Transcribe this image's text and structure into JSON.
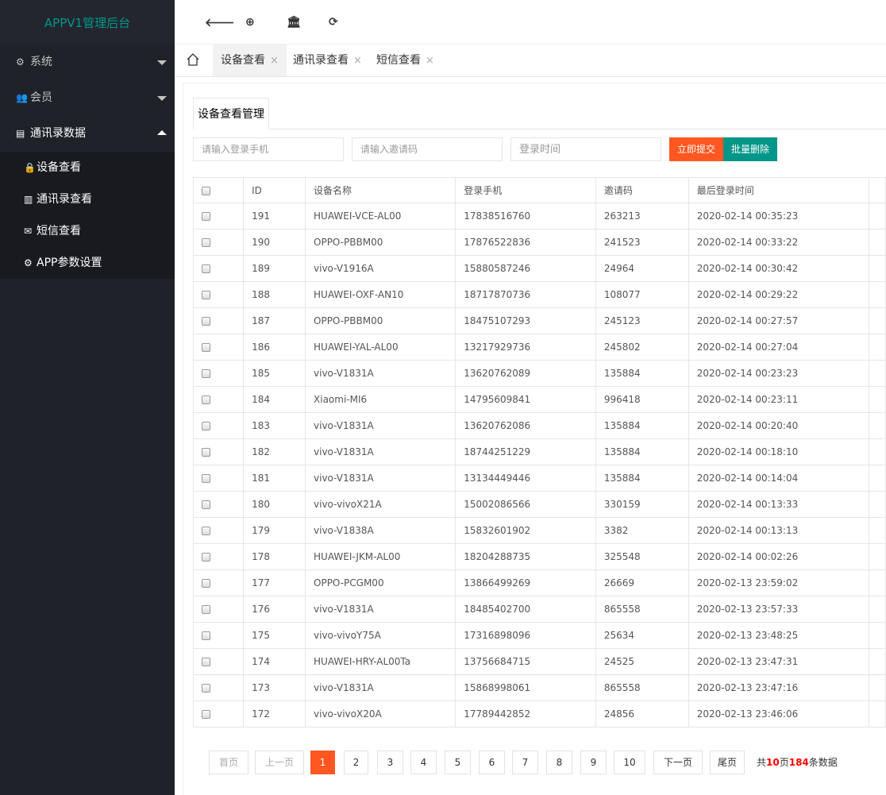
{
  "app": {
    "title": "APPV1管理后台"
  },
  "sidebar": {
    "items": [
      {
        "label": "系统",
        "icon": "gear-icon",
        "glyph": "⚙"
      },
      {
        "label": "会员",
        "icon": "users-icon",
        "glyph": "👥"
      },
      {
        "label": "通讯录数据",
        "icon": "card-icon",
        "glyph": "▤"
      }
    ],
    "subitems": [
      {
        "label": "设备查看",
        "icon": "lock-icon",
        "glyph": "🔒"
      },
      {
        "label": "通讯录查看",
        "icon": "building-icon",
        "glyph": "▥"
      },
      {
        "label": "短信查看",
        "icon": "envelope-icon",
        "glyph": "✉"
      },
      {
        "label": "APP参数设置",
        "icon": "gear-icon",
        "glyph": "⚙"
      }
    ]
  },
  "header": {
    "back": "🡐",
    "support": "⊕",
    "bank": "🏛",
    "refresh": "⟳"
  },
  "tabs": [
    {
      "label": "设备查看",
      "close": "×"
    },
    {
      "label": "通讯录查看",
      "close": "×"
    },
    {
      "label": "短信查看",
      "close": "×"
    }
  ],
  "panel": {
    "title": "设备查看管理",
    "phone_placeholder": "请输入登录手机",
    "code_placeholder": "请输入邀请码",
    "time_placeholder": "登录时间",
    "submit": "立即提交",
    "batch_delete": "批量删除"
  },
  "table": {
    "headers": [
      "ID",
      "设备名称",
      "登录手机",
      "邀请码",
      "最后登录时间"
    ],
    "rows": [
      [
        "191",
        "HUAWEI-VCE-AL00",
        "17838516760",
        "263213",
        "2020-02-14 00:35:23"
      ],
      [
        "190",
        "OPPO-PBBM00",
        "17876522836",
        "241523",
        "2020-02-14 00:33:22"
      ],
      [
        "189",
        "vivo-V1916A",
        "15880587246",
        "24964",
        "2020-02-14 00:30:42"
      ],
      [
        "188",
        "HUAWEI-OXF-AN10",
        "18717870736",
        "108077",
        "2020-02-14 00:29:22"
      ],
      [
        "187",
        "OPPO-PBBM00",
        "18475107293",
        "245123",
        "2020-02-14 00:27:57"
      ],
      [
        "186",
        "HUAWEI-YAL-AL00",
        "13217929736",
        "245802",
        "2020-02-14 00:27:04"
      ],
      [
        "185",
        "vivo-V1831A",
        "13620762089",
        "135884",
        "2020-02-14 00:23:23"
      ],
      [
        "184",
        "Xiaomi-MI6",
        "14795609841",
        "996418",
        "2020-02-14 00:23:11"
      ],
      [
        "183",
        "vivo-V1831A",
        "13620762086",
        "135884",
        "2020-02-14 00:20:40"
      ],
      [
        "182",
        "vivo-V1831A",
        "18744251229",
        "135884",
        "2020-02-14 00:18:10"
      ],
      [
        "181",
        "vivo-V1831A",
        "13134449446",
        "135884",
        "2020-02-14 00:14:04"
      ],
      [
        "180",
        "vivo-vivoX21A",
        "15002086566",
        "330159",
        "2020-02-14 00:13:33"
      ],
      [
        "179",
        "vivo-V1838A",
        "15832601902",
        "3382",
        "2020-02-14 00:13:13"
      ],
      [
        "178",
        "HUAWEI-JKM-AL00",
        "18204288735",
        "325548",
        "2020-02-14 00:02:26"
      ],
      [
        "177",
        "OPPO-PCGM00",
        "13866499269",
        "26669",
        "2020-02-13 23:59:02"
      ],
      [
        "176",
        "vivo-V1831A",
        "18485402700",
        "865558",
        "2020-02-13 23:57:33"
      ],
      [
        "175",
        "vivo-vivoY75A",
        "17316898096",
        "25634",
        "2020-02-13 23:48:25"
      ],
      [
        "174",
        "HUAWEI-HRY-AL00Ta",
        "13756684715",
        "24525",
        "2020-02-13 23:47:31"
      ],
      [
        "173",
        "vivo-V1831A",
        "15868998061",
        "865558",
        "2020-02-13 23:47:16"
      ],
      [
        "172",
        "vivo-vivoX20A",
        "17789442852",
        "24856",
        "2020-02-13 23:46:06"
      ]
    ]
  },
  "pagination": {
    "first": "首页",
    "prev": "上一页",
    "pages": [
      "1",
      "2",
      "3",
      "4",
      "5",
      "6",
      "7",
      "8",
      "9",
      "10"
    ],
    "current": "1",
    "next": "下一页",
    "last": "尾页",
    "info_prefix": "共",
    "total_pages": "10",
    "info_mid": "页",
    "total_records": "184",
    "info_suffix": "条数据"
  },
  "colors": {
    "accent": "#009688",
    "danger": "#ff5722",
    "sidebar_bg": "#20222a"
  }
}
